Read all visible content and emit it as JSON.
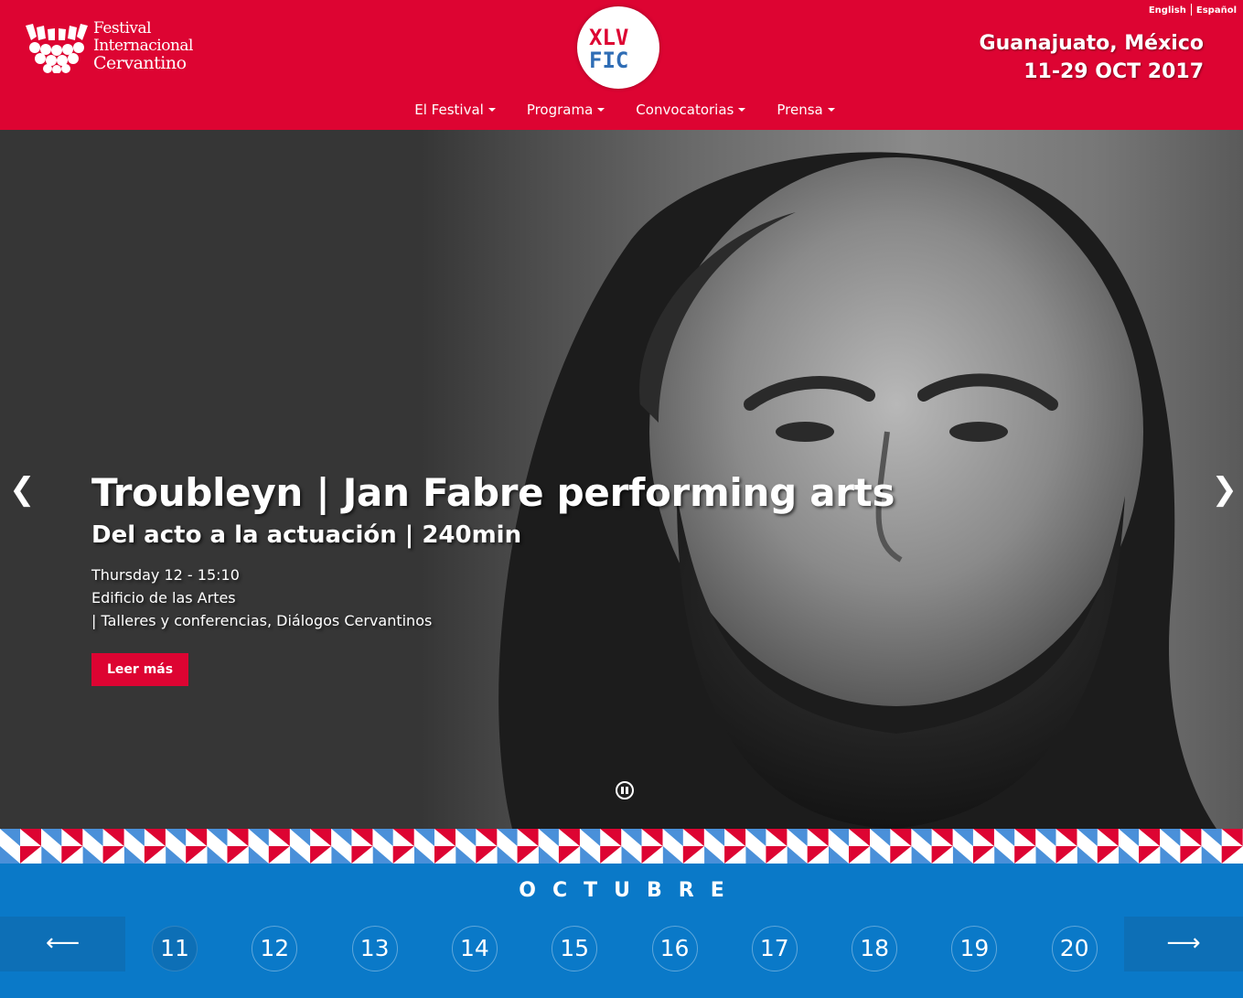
{
  "header": {
    "logo_lines": [
      "Festival",
      "Internacional",
      "Cervantino"
    ],
    "badge_text": [
      "XLV",
      "FIC"
    ],
    "languages": [
      "English",
      "Español"
    ],
    "city": "Guanajuato, México",
    "dates": "11-29 OCT 2017",
    "nav": [
      "El Festival",
      "Programa",
      "Convocatorias",
      "Prensa"
    ]
  },
  "hero": {
    "title": "Troubleyn | Jan Fabre performing arts",
    "subtitle": "Del acto a la actuación | 240min",
    "lines": [
      "Thursday 12 - 15:10",
      "Edificio de las Artes",
      "| Talleres y conferencias, Diálogos Cervantinos"
    ],
    "button": "Leer más",
    "prev_icon": "chevron-left-icon",
    "next_icon": "chevron-right-icon"
  },
  "calendar": {
    "month": "OCTUBRE",
    "days": [
      "11",
      "12",
      "13",
      "14",
      "15",
      "16",
      "17",
      "18",
      "19",
      "20"
    ],
    "active_day": "11",
    "prev_icon": "arrow-left-icon",
    "next_icon": "arrow-right-icon"
  },
  "colors": {
    "brand_red": "#dd0432",
    "brand_blue": "#0a79c8",
    "pattern_blue": "#4a90d9"
  }
}
